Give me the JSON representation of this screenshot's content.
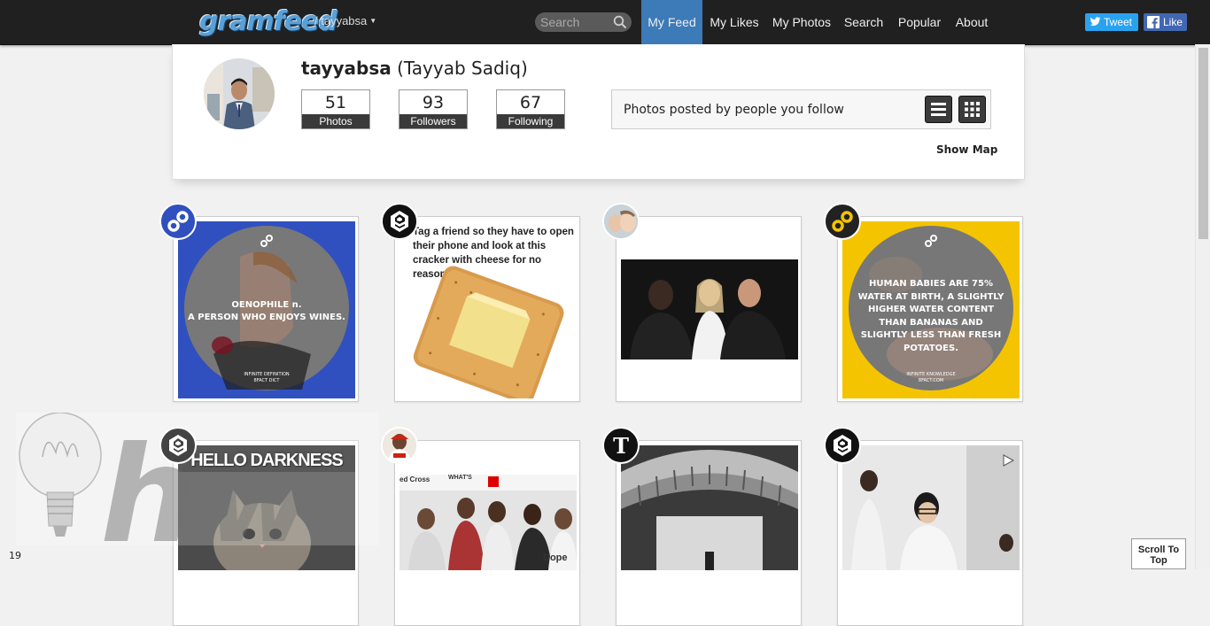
{
  "header": {
    "logo": "gramfeed",
    "username": "/ tayyabsa",
    "search_placeholder": "Search",
    "nav": [
      "My Feed",
      "My Likes",
      "My Photos",
      "Search",
      "Popular",
      "About"
    ],
    "tweet_label": "Tweet",
    "like_label": "Like"
  },
  "profile": {
    "username": "tayyabsa",
    "fullname": "(Tayyab Sadiq)",
    "stats": [
      {
        "value": "51",
        "label": "Photos"
      },
      {
        "value": "93",
        "label": "Followers"
      },
      {
        "value": "67",
        "label": "Following"
      }
    ],
    "filter_text": "Photos posted by people you follow",
    "show_map": "Show Map"
  },
  "posts": {
    "p1_line1": "OENOPHILE n.",
    "p1_line2": "A PERSON WHO ENJOYS WINES.",
    "p1_foot1": "INFINITE DEFINITION",
    "p1_foot2": "8FACT DICT",
    "p2_caption": "Tag a friend so they have to open their phone and look at this cracker with cheese for no reason",
    "p4_text": "HUMAN BABIES ARE 75% WATER AT BIRTH, A SLIGHTLY HIGHER WATER CONTENT THAN BANANAS AND SLIGHTLY LESS THAN FRESH POTATOES.",
    "p4_foot1": "INFINITE KNOWLEDGE",
    "p4_foot2": "8FACT.COM",
    "p5_caption": "HELLO DARKNESS",
    "p6_sign": "ed Cross",
    "p6_sign2": "WHAT'S",
    "p6_shirt": "Dope"
  },
  "footer": {
    "page_number": "19",
    "scroll_top": "Scroll To Top"
  },
  "colors": {
    "nav_bg": "#202020",
    "nav_active": "#3d7ab8",
    "tweet": "#2aa3ef",
    "facebook": "#4267b2",
    "eightfact_yellow": "#f4c400",
    "eightfact_blue": "#3050c0"
  }
}
